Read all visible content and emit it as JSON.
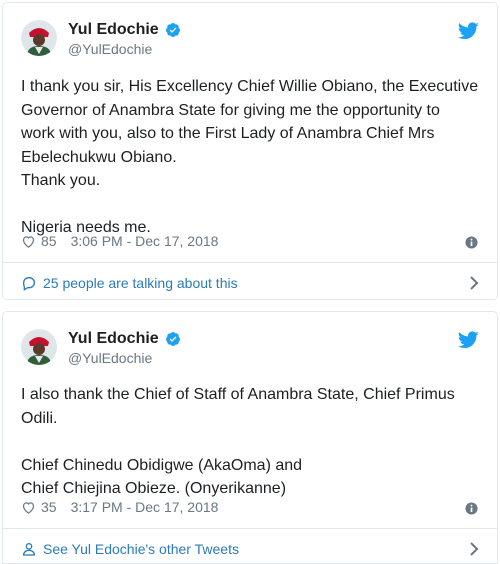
{
  "tweets": [
    {
      "display_name": "Yul Edochie",
      "handle": "@YulEdochie",
      "text": "I thank you sir, His Excellency Chief Willie Obiano, the Executive\nGovernor of Anambra State for giving me the opportunity to\nwork with you, also to the First Lady of Anambra Chief Mrs\nEbelechukwu Obiano.\nThank you.\n\nNigeria needs me.",
      "likes": "85",
      "timestamp": "3:06 PM - Dec 17, 2018",
      "footer_label": "25 people are talking about this",
      "footer_icon": "speech-bubble-icon"
    },
    {
      "display_name": "Yul Edochie",
      "handle": "@YulEdochie",
      "text": "I also thank the Chief of Staff of Anambra State, Chief Primus\nOdili.\n\nChief Chinedu Obidigwe (AkaOma) and\nChief Chiejina Obieze. (Onyerikanne)",
      "likes": "35",
      "timestamp": "3:17 PM - Dec 17, 2018",
      "footer_label": "See Yul Edochie's other Tweets",
      "footer_icon": "person-icon"
    }
  ],
  "colors": {
    "link": "#2b7bb9",
    "twitter_blue": "#1da1f2",
    "muted": "#697882",
    "border": "#e1e8ed"
  }
}
